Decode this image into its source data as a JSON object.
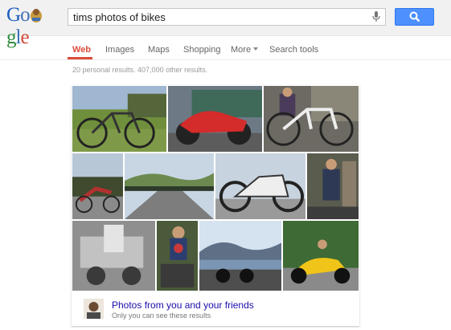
{
  "logo": {
    "text": "Google"
  },
  "search": {
    "query": "tims photos of bikes"
  },
  "tabs": [
    {
      "label": "Web",
      "active": true
    },
    {
      "label": "Images"
    },
    {
      "label": "Maps"
    },
    {
      "label": "Shopping"
    },
    {
      "label": "More"
    },
    {
      "label": "Search tools"
    }
  ],
  "results_stats": "20 personal results. 407,000 other results.",
  "photos_card": {
    "title": "Photos from you and your friends",
    "subtitle": "Only you can see these results"
  },
  "colors": {
    "accent_red": "#dd4b39",
    "search_button": "#4d90fe",
    "link_blue": "#1a0dab"
  }
}
